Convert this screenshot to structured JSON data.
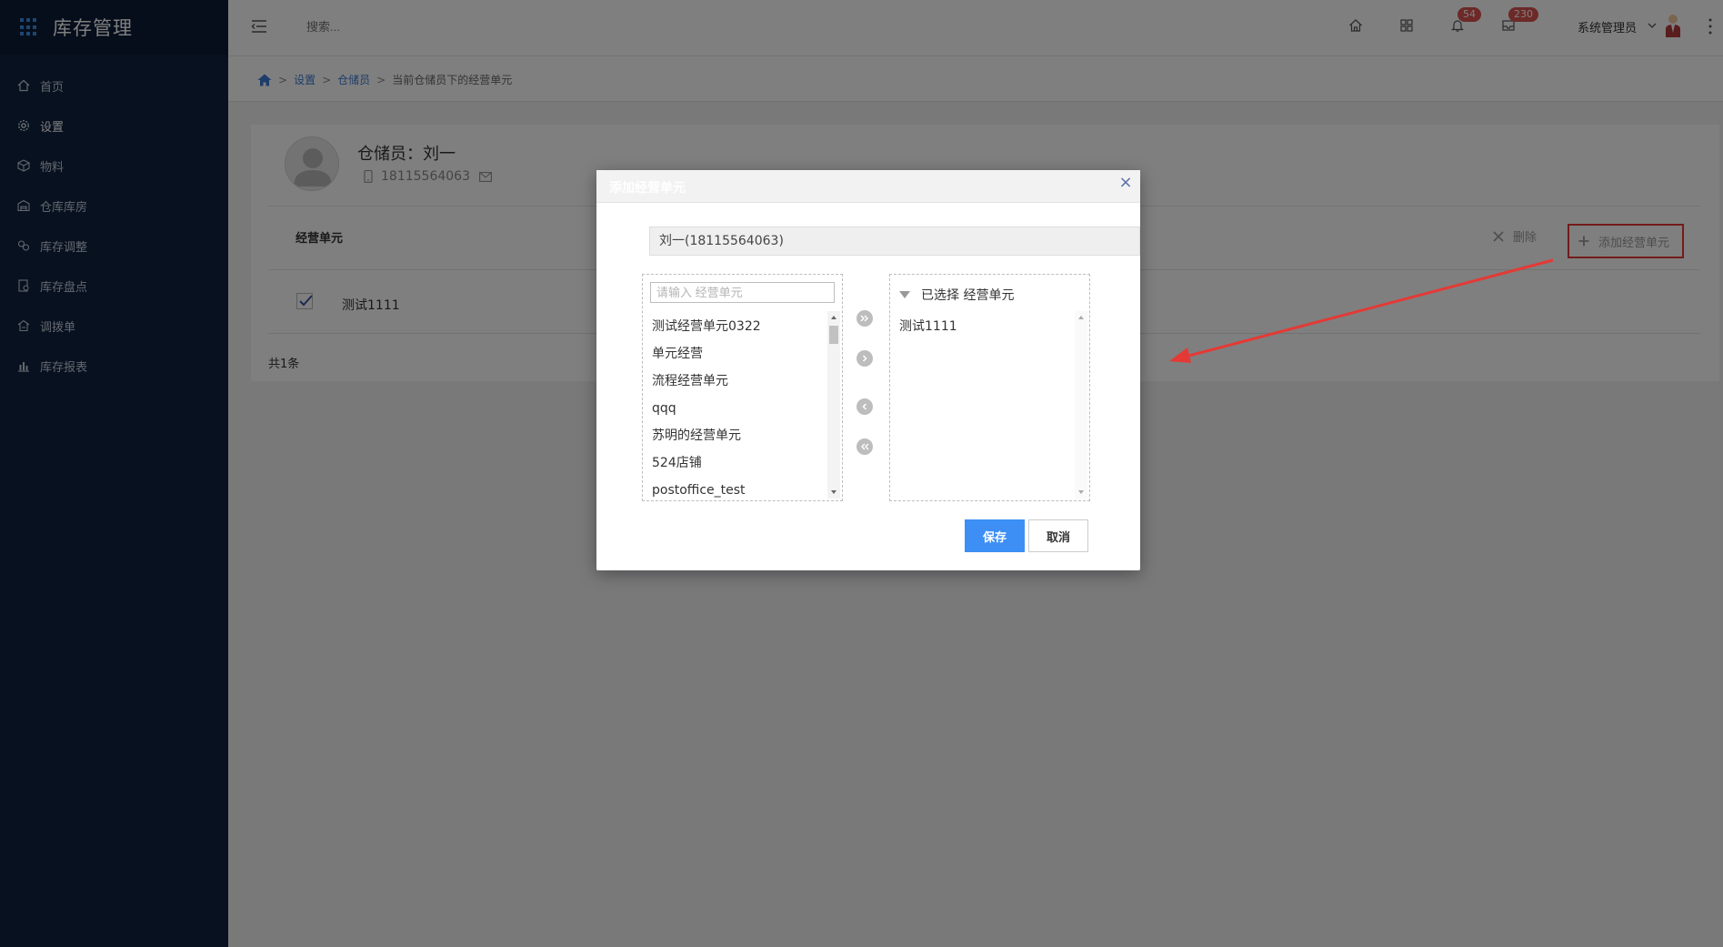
{
  "app": {
    "title": "库存管理"
  },
  "sidebar": {
    "items": [
      {
        "label": "首页",
        "icon": "home-icon"
      },
      {
        "label": "设置",
        "icon": "gear-icon"
      },
      {
        "label": "物料",
        "icon": "box-icon"
      },
      {
        "label": "仓库库房",
        "icon": "warehouse-icon"
      },
      {
        "label": "库存调整",
        "icon": "adjust-icon"
      },
      {
        "label": "库存盘点",
        "icon": "inventory-check-icon"
      },
      {
        "label": "调拨单",
        "icon": "transfer-icon"
      },
      {
        "label": "库存报表",
        "icon": "bar-chart-icon"
      }
    ]
  },
  "header": {
    "search_placeholder": "搜索...",
    "notifications_count": "54",
    "messages_count": "230",
    "user_name": "系统管理员"
  },
  "breadcrumb": {
    "items": [
      "设置",
      "仓储员"
    ],
    "current": "当前仓储员下的经营单元"
  },
  "profile": {
    "name": "仓储员：刘一",
    "phone": "18115564063"
  },
  "section": {
    "title": "经营单元",
    "delete_label": "删除",
    "add_label": "添加经营单元"
  },
  "table": {
    "rows": [
      {
        "name": "测试1111",
        "checked": true
      }
    ],
    "total": "共1条"
  },
  "modal": {
    "title": "添加经营单元",
    "user_value": "刘一(18115564063)",
    "search_placeholder": "请输入 经营单元",
    "available": [
      "测试经营单元0322",
      "单元经营",
      "流程经营单元",
      "qqq",
      "苏明的经营单元",
      "524店铺",
      "postoffice_test"
    ],
    "selected_header": "已选择 经营单元",
    "selected": [
      "测试1111"
    ],
    "save_label": "保存",
    "cancel_label": "取消"
  },
  "colors": {
    "sidebar_bg": "#0f2240",
    "accent": "#3d8ff5",
    "badge": "#d9534f",
    "annotation": "#e53935"
  }
}
